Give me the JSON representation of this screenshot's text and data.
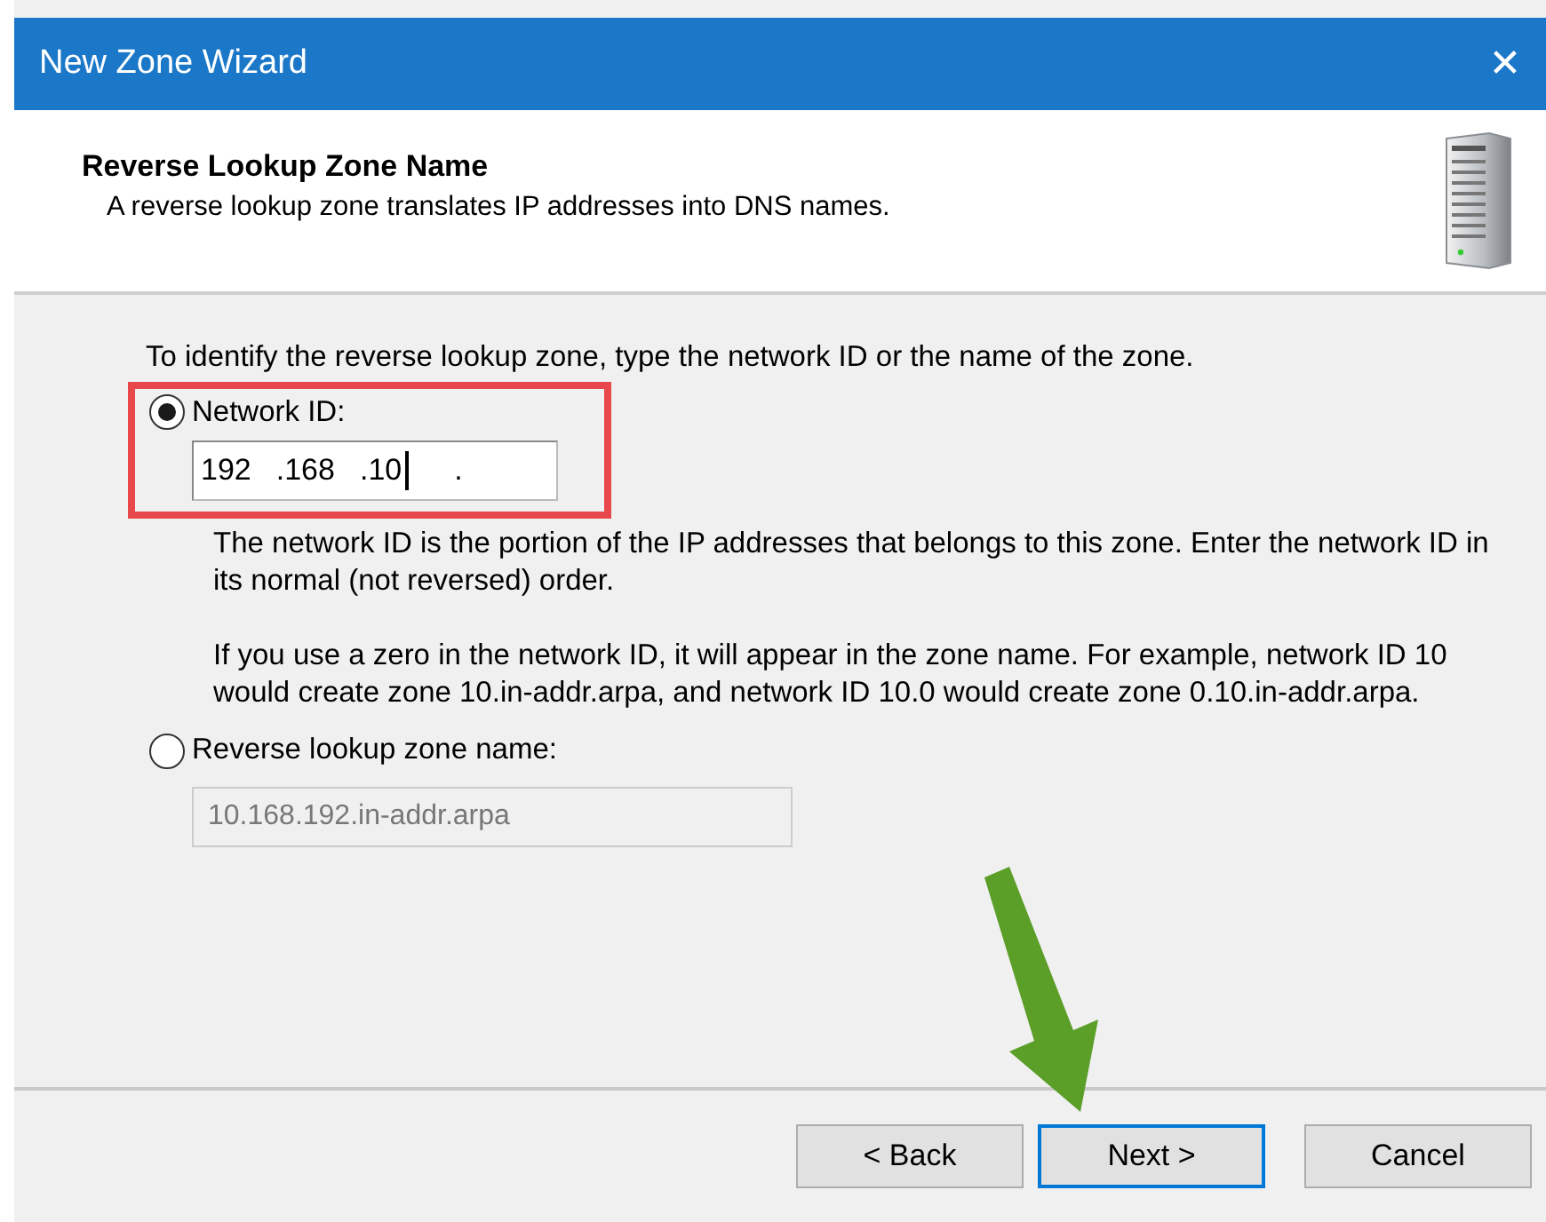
{
  "window": {
    "title": "New Zone Wizard",
    "close": "✕"
  },
  "header": {
    "title": "Reverse Lookup Zone Name",
    "subtitle": "A reverse lookup zone translates IP addresses into DNS names."
  },
  "intro": "To identify the reverse lookup zone, type the network ID or the name of the zone.",
  "options": [
    {
      "label": "Network ID:",
      "selected": true,
      "highlighted": true,
      "field": {
        "kind": "ip",
        "disabled": false,
        "segments": [
          {
            "text": "192",
            "cursor": false
          },
          {
            "text": ".168",
            "cursor": false
          },
          {
            "text": ".10",
            "cursor": true
          },
          {
            "text": ".",
            "cursor": false
          }
        ]
      },
      "notes": [
        "The network ID is the portion of the IP addresses that belongs to this zone. Enter the network ID in its normal (not reversed) order.",
        "If you use a zero in the network ID, it will appear in the zone name. For example, network ID 10 would create zone 10.in-addr.arpa, and network ID 10.0 would create zone 0.10.in-addr.arpa."
      ]
    },
    {
      "label": "Reverse lookup zone name:",
      "selected": false,
      "highlighted": false,
      "field": {
        "kind": "text",
        "disabled": true,
        "value": "10.168.192.in-addr.arpa"
      }
    }
  ],
  "buttons": [
    {
      "label": "< Back",
      "default": false
    },
    {
      "label": "Next >",
      "default": true
    },
    {
      "label": "Cancel",
      "default": false
    }
  ]
}
